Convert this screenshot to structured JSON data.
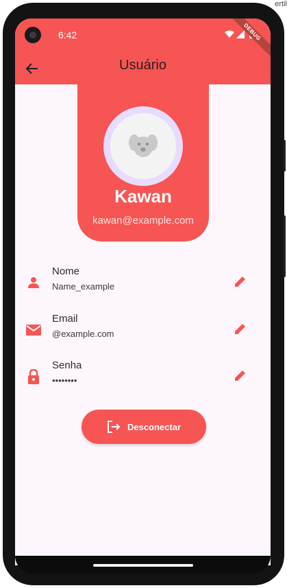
{
  "status_bar": {
    "time": "6:42",
    "debug_label": "DEBUG"
  },
  "app_bar": {
    "title": "Usuário"
  },
  "profile": {
    "name": "Kawan",
    "email": "kawan@example.com"
  },
  "fields": [
    {
      "label": "Nome",
      "value": "Name_example",
      "icon": "person-icon"
    },
    {
      "label": "Email",
      "value": "@example.com",
      "icon": "mail-icon"
    },
    {
      "label": "Senha",
      "value": "••••••••",
      "icon": "lock-icon"
    }
  ],
  "logout": {
    "label": "Desconectar",
    "icon": "logout-icon"
  },
  "offscreen_text": "ertil",
  "colors": {
    "accent": "#f75454",
    "background": "#fdf7fd",
    "avatar_ring": "#e8dcfe"
  }
}
